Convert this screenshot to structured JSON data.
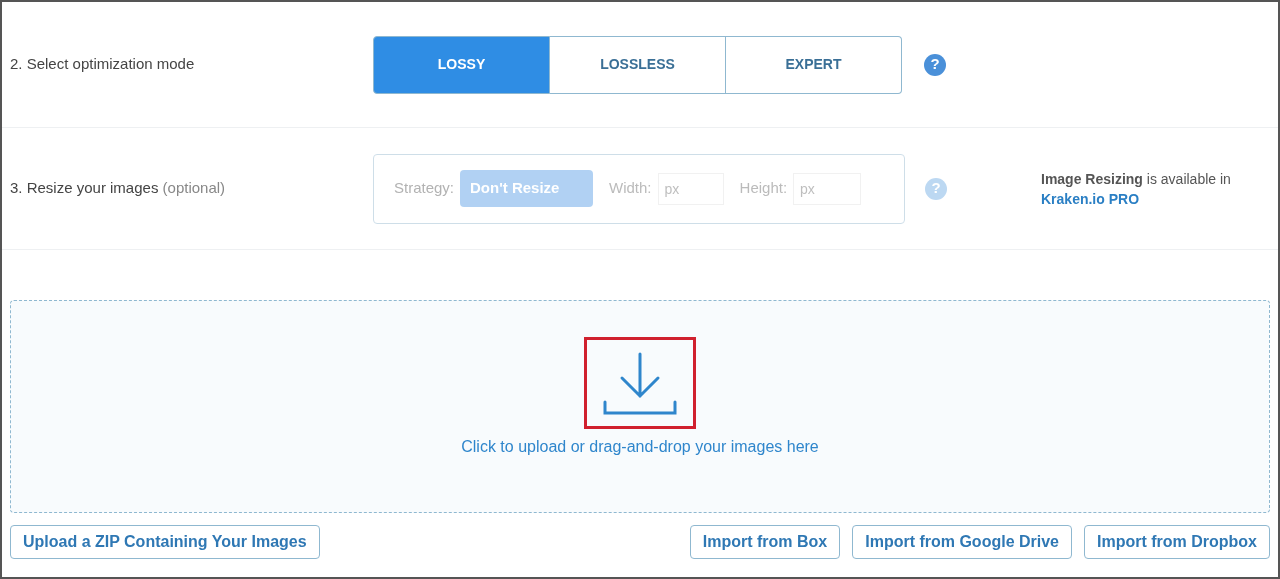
{
  "mode_step": {
    "label": "2. Select optimization mode",
    "help": "?",
    "options": [
      {
        "label": "LOSSY",
        "selected": true
      },
      {
        "label": "LOSSLESS",
        "selected": false
      },
      {
        "label": "EXPERT",
        "selected": false
      }
    ]
  },
  "resize_step": {
    "label": "3. Resize your images",
    "note": "(optional)",
    "disabled": true,
    "help": "?",
    "strategy": {
      "label": "Strategy:",
      "value": "Don't Resize"
    },
    "width": {
      "label": "Width:",
      "placeholder": "px"
    },
    "height": {
      "label": "Height:",
      "placeholder": "px"
    },
    "notice": "**Image Resizing** is available in",
    "notice_link": "Kraken.io PRO"
  },
  "dropzone": {
    "text": "Click to upload or drag-and-drop your images here",
    "highlighted": true
  },
  "buttons_left": [
    "Upload a ZIP Containing Your Images"
  ],
  "buttons_right": [
    "Import from Box",
    "Import from Google Drive",
    "Import from Dropbox"
  ]
}
